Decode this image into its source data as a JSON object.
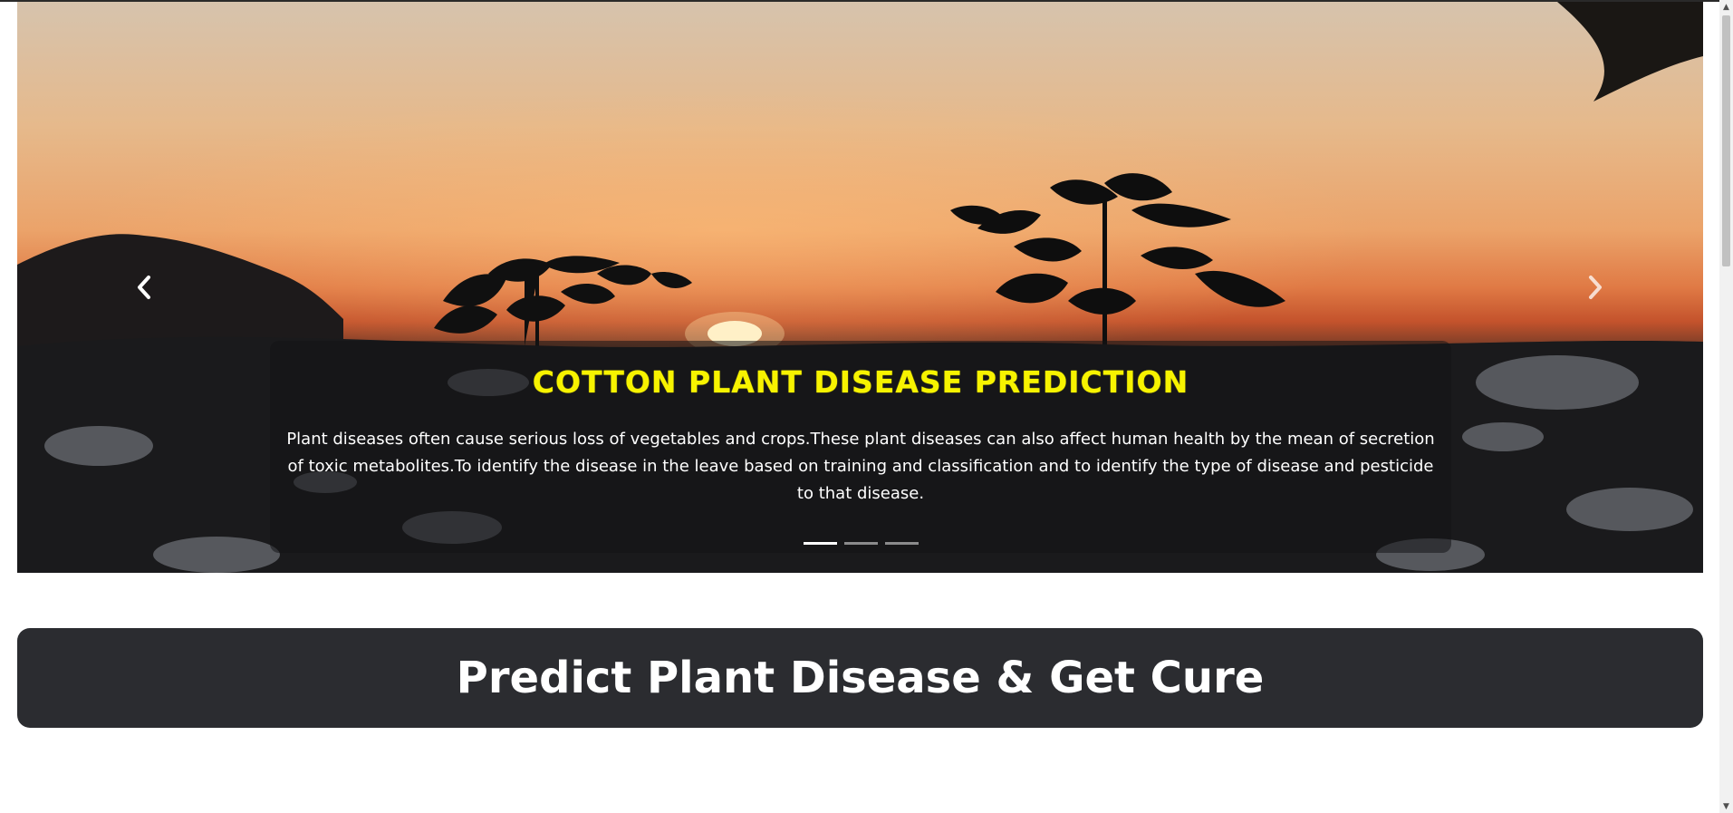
{
  "carousel": {
    "slides_count": 3,
    "active_slide": 1,
    "caption": {
      "title": "COTTON PLANT DISEASE PREDICTION",
      "text": "Plant diseases often cause serious loss of vegetables and crops.These plant diseases can also affect human health by the mean of secretion of toxic metabolites.To identify the disease in the leave based on training and classification and to identify the type of disease and pesticide to that disease."
    },
    "prev_icon": "chevron-left-icon",
    "next_icon": "chevron-right-icon",
    "title_color": "#f7f300"
  },
  "banner": {
    "heading": "Predict Plant Disease & Get Cure",
    "background": "#2b2c30"
  },
  "scrollbar": {
    "up_icon": "arrow-up-icon",
    "down_icon": "arrow-down-icon"
  }
}
